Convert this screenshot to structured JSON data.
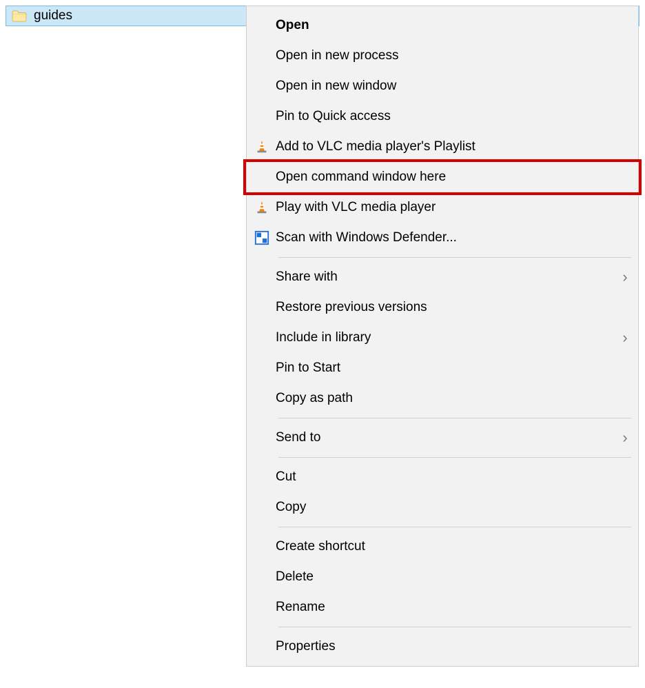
{
  "folder": {
    "name": "guides"
  },
  "context_menu": {
    "items": [
      {
        "label": "Open",
        "bold": true
      },
      {
        "label": "Open in new process"
      },
      {
        "label": "Open in new window"
      },
      {
        "label": "Pin to Quick access"
      },
      {
        "label": "Add to VLC media player's Playlist",
        "icon": "vlc"
      },
      {
        "label": "Open command window here",
        "highlighted": true
      },
      {
        "label": "Play with VLC media player",
        "icon": "vlc"
      },
      {
        "label": "Scan with Windows Defender...",
        "icon": "defender"
      },
      {
        "separator": true
      },
      {
        "label": "Share with",
        "submenu": true
      },
      {
        "label": "Restore previous versions"
      },
      {
        "label": "Include in library",
        "submenu": true
      },
      {
        "label": "Pin to Start"
      },
      {
        "label": "Copy as path"
      },
      {
        "separator": true
      },
      {
        "label": "Send to",
        "submenu": true
      },
      {
        "separator": true
      },
      {
        "label": "Cut"
      },
      {
        "label": "Copy"
      },
      {
        "separator": true
      },
      {
        "label": "Create shortcut"
      },
      {
        "label": "Delete"
      },
      {
        "label": "Rename"
      },
      {
        "separator": true
      },
      {
        "label": "Properties"
      }
    ]
  },
  "icons": {
    "submenu_glyph": "›"
  }
}
